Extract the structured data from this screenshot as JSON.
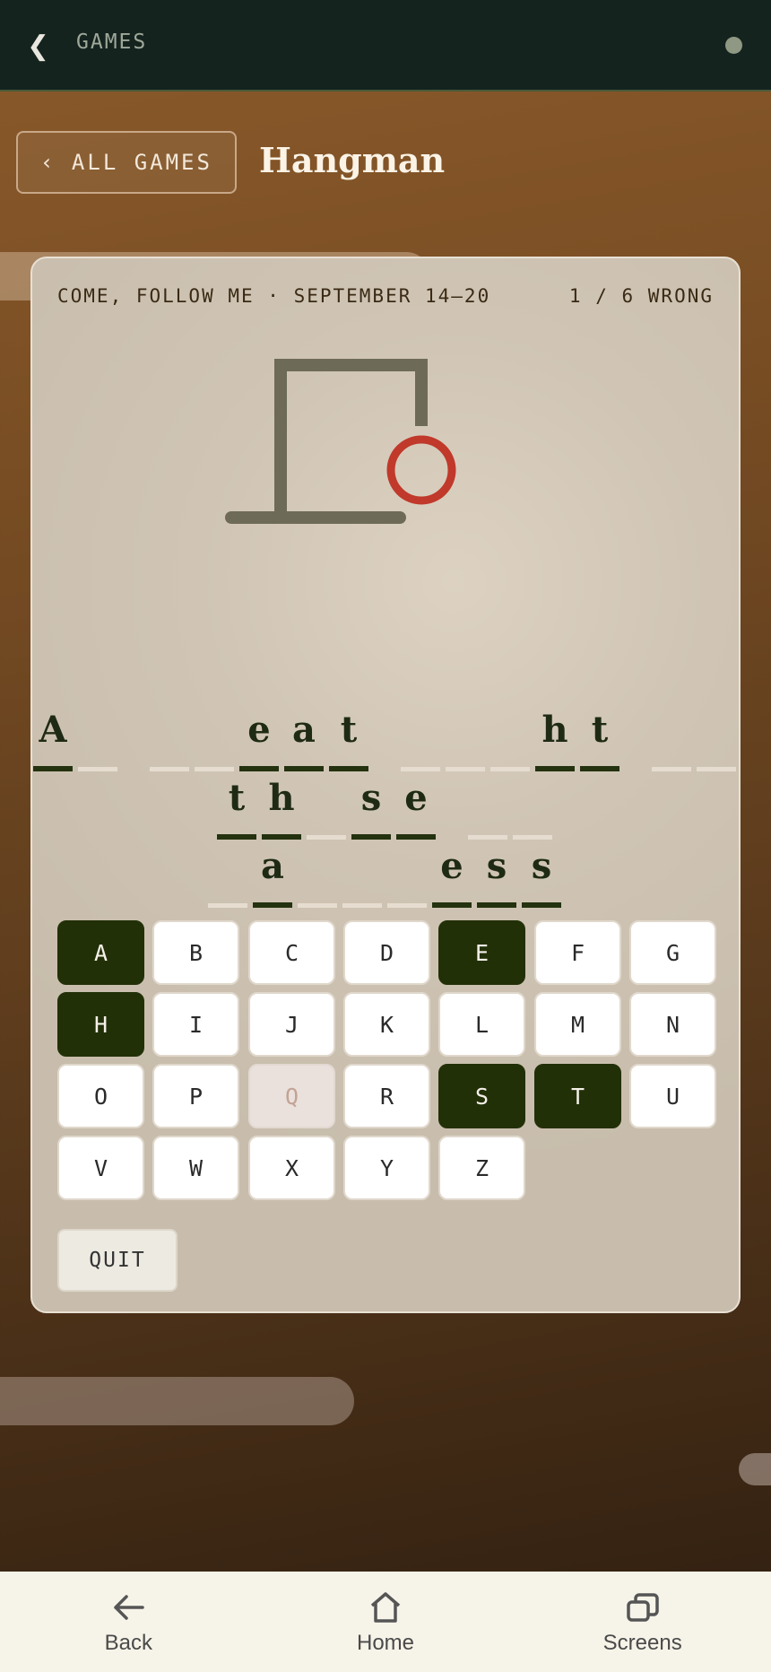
{
  "topbar": {
    "title": "GAMES"
  },
  "header": {
    "all_games_label": "‹ ALL GAMES",
    "page_title": "Hangman"
  },
  "card": {
    "subtitle": "COME, FOLLOW ME · SEPTEMBER 14–20",
    "wrong_count": "1 / 6 WRONG",
    "phrase_rows": [
      [
        "A",
        "",
        " ",
        "",
        "",
        "e",
        "a",
        "t",
        " ",
        "",
        "",
        "",
        "h",
        "t",
        " ",
        "",
        ""
      ],
      [
        "t",
        "h",
        "",
        "s",
        "e",
        " ",
        "",
        ""
      ],
      [
        "",
        "a",
        "",
        "",
        "",
        "e",
        "s",
        "s"
      ]
    ]
  },
  "keyboard": {
    "letters": [
      "A",
      "B",
      "C",
      "D",
      "E",
      "F",
      "G",
      "H",
      "I",
      "J",
      "K",
      "L",
      "M",
      "N",
      "O",
      "P",
      "Q",
      "R",
      "S",
      "T",
      "U",
      "V",
      "W",
      "X",
      "Y",
      "Z"
    ],
    "correct": [
      "A",
      "E",
      "H",
      "S",
      "T"
    ],
    "wrong": [
      "Q"
    ]
  },
  "actions": {
    "quit_label": "QUIT"
  },
  "bottomnav": {
    "back_label": "Back",
    "home_label": "Home",
    "screens_label": "Screens"
  },
  "colors": {
    "topbar": "#15231f",
    "used_key": "#223008",
    "noose_head": "#c0392b",
    "gallows": "#6e6a58"
  }
}
